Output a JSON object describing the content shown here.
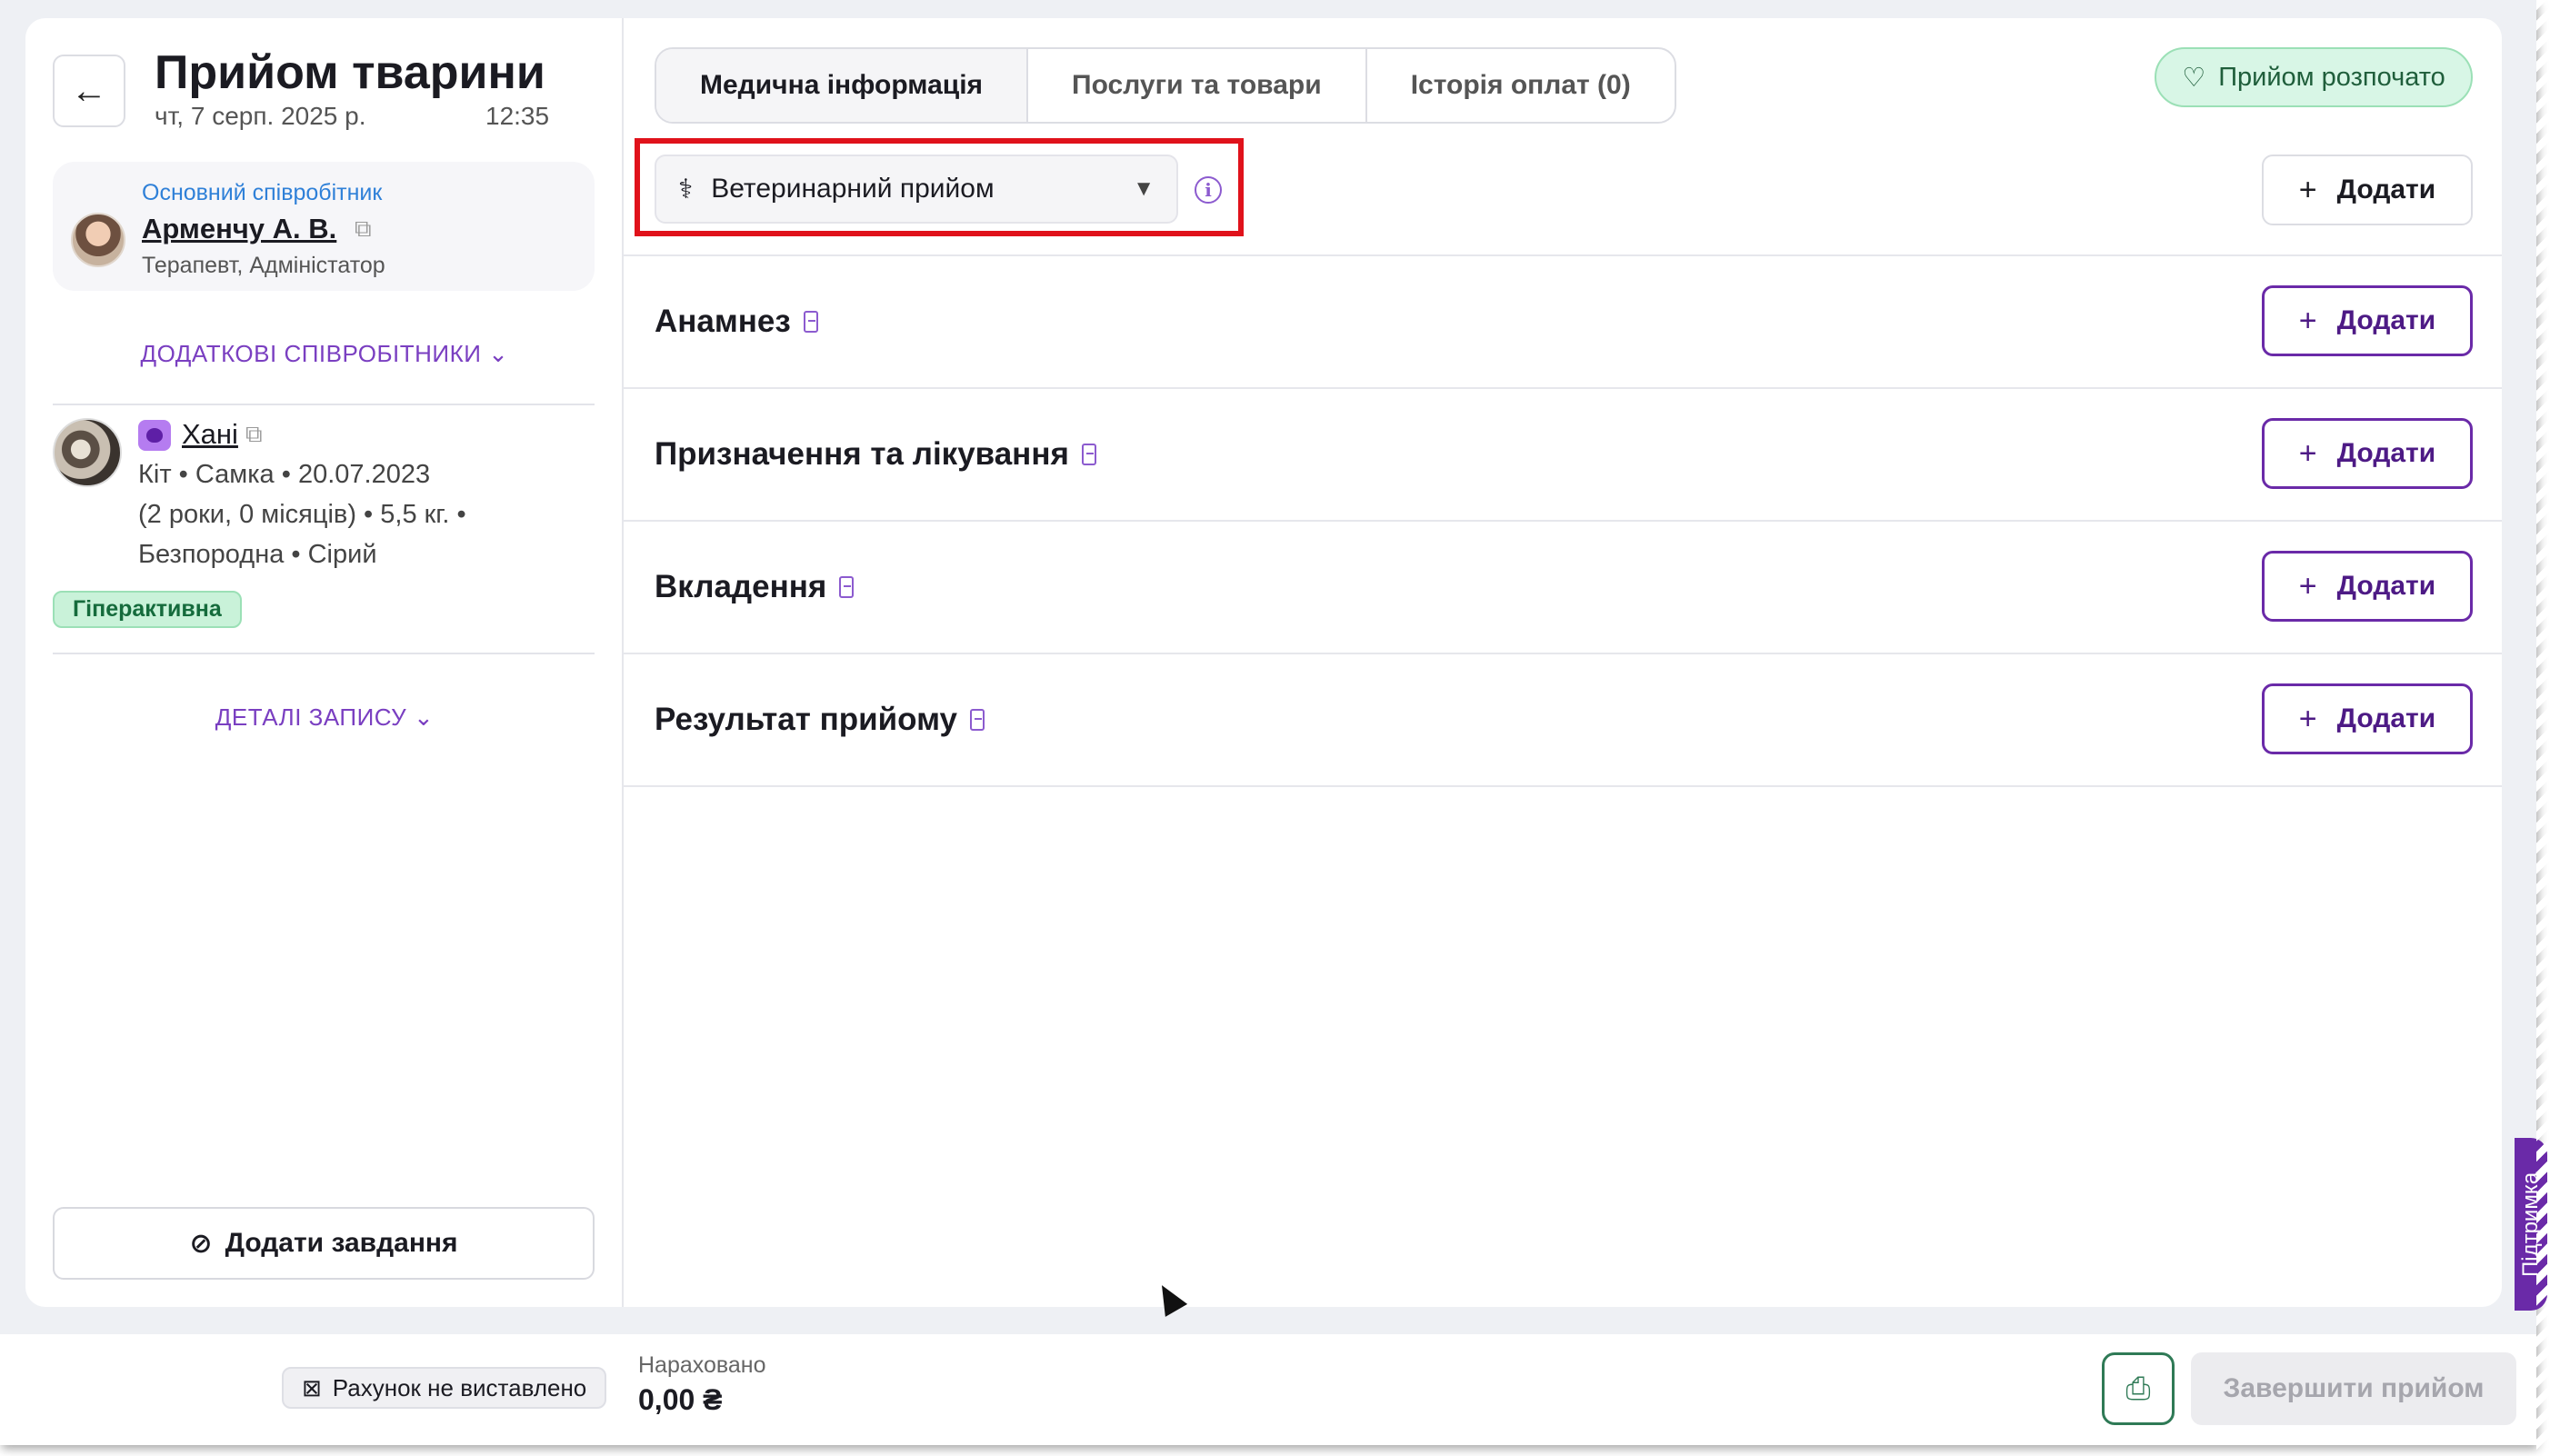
{
  "header": {
    "title": "Прийом тварини",
    "date": "чт, 7 серп. 2025 р.",
    "time": "12:35"
  },
  "employee": {
    "role_label": "Основний співробітник",
    "name": "Арменчу А. В.",
    "position": "Терапевт, Адміністатор"
  },
  "more_staff_label": "ДОДАТКОВІ СПІВРОБІТНИКИ",
  "pet": {
    "name": "Хані",
    "line1": "Кіт • Самка • 20.07.2023",
    "line2": "(2 роки, 0 місяців) • 5,5 кг. •",
    "line3": "Безпородна • Сірий",
    "badge": "Гіперактивна",
    "tag_color": "#b57cf0"
  },
  "record_details_label": "ДЕТАЛІ ЗАПИСУ",
  "add_task_label": "Додати завдання",
  "tabs": [
    {
      "label": "Медична інформація"
    },
    {
      "label": "Послуги та товари"
    },
    {
      "label": "Історія оплат (0)"
    }
  ],
  "status_label": "Прийом розпочато",
  "visit_type": "Ветеринарний прийом",
  "add_label": "Додати",
  "sections": [
    {
      "title": "Анамнез"
    },
    {
      "title": "Призначення та лікування"
    },
    {
      "title": "Вкладення"
    },
    {
      "title": "Результат прийому"
    }
  ],
  "footer": {
    "invoice_status": "Рахунок не виставлено",
    "accrued_label": "Нараховано",
    "accrued_value": "0,00 ₴",
    "finish_label": "Завершити прийом"
  },
  "support_label": "Підтримка",
  "colors": {
    "accent": "#6a2aa8",
    "status_bg": "#d8f6e6",
    "highlight": "#e0121b",
    "link_blue": "#2f80d8"
  }
}
